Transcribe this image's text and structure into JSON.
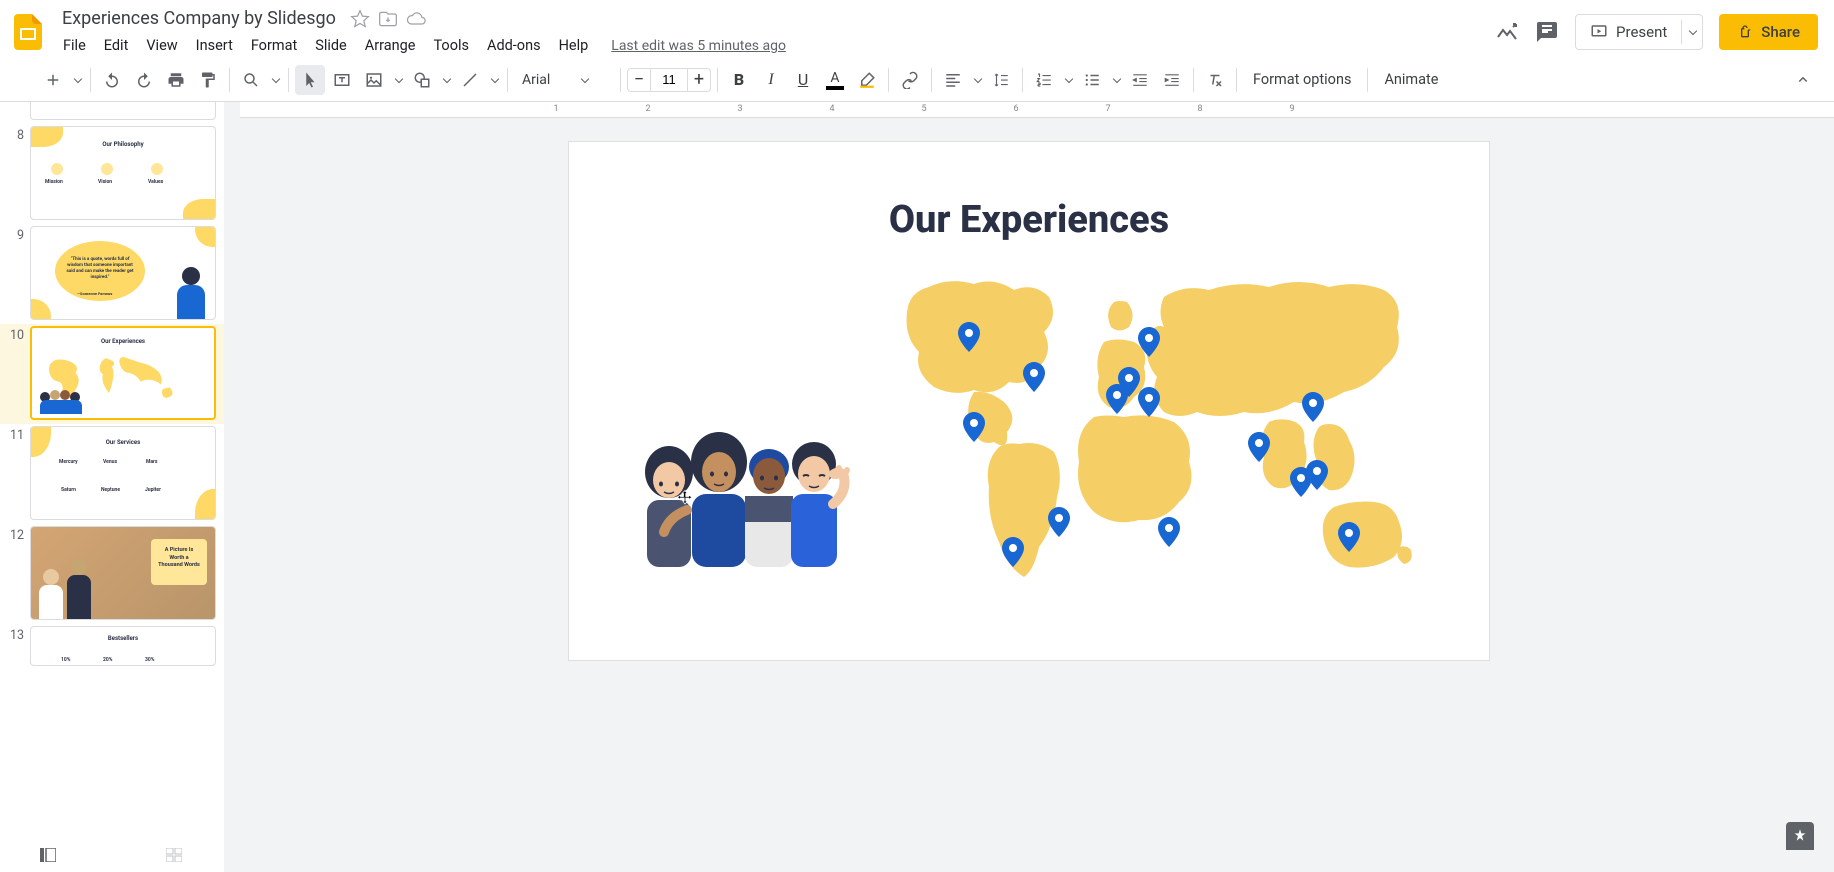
{
  "header": {
    "doc_title": "Experiences Company by Slidesgo",
    "last_edit": "Last edit was 5 minutes ago",
    "present_label": "Present",
    "share_label": "Share"
  },
  "menus": [
    "File",
    "Edit",
    "View",
    "Insert",
    "Format",
    "Slide",
    "Arrange",
    "Tools",
    "Add-ons",
    "Help"
  ],
  "toolbar": {
    "font_name": "Arial",
    "font_size": "11",
    "format_options": "Format options",
    "animate": "Animate"
  },
  "sidebar": {
    "slides": [
      {
        "num": "8",
        "title": "Our Philosophy",
        "sub1": "Mission",
        "sub2": "Vision",
        "sub3": "Values"
      },
      {
        "num": "9",
        "title": "“This is a quote, words full of wisdom that someone important said and can make the reader get inspired.”",
        "author": "—Someone Famous"
      },
      {
        "num": "10",
        "title": "Our Experiences"
      },
      {
        "num": "11",
        "title": "Our Services",
        "a": "Mercury",
        "b": "Venus",
        "c": "Mars",
        "d": "Saturn",
        "e": "Neptune",
        "f": "Jupiter"
      },
      {
        "num": "12",
        "title": "A Picture Is Worth a Thousand Words"
      },
      {
        "num": "13",
        "title": "Bestsellers",
        "p1": "10%",
        "p2": "20%",
        "p3": "30%"
      }
    ]
  },
  "canvas": {
    "slide_title": "Our Experiences"
  },
  "ruler_ticks": [
    "1",
    "2",
    "3",
    "4",
    "5",
    "6",
    "7",
    "8",
    "9"
  ]
}
